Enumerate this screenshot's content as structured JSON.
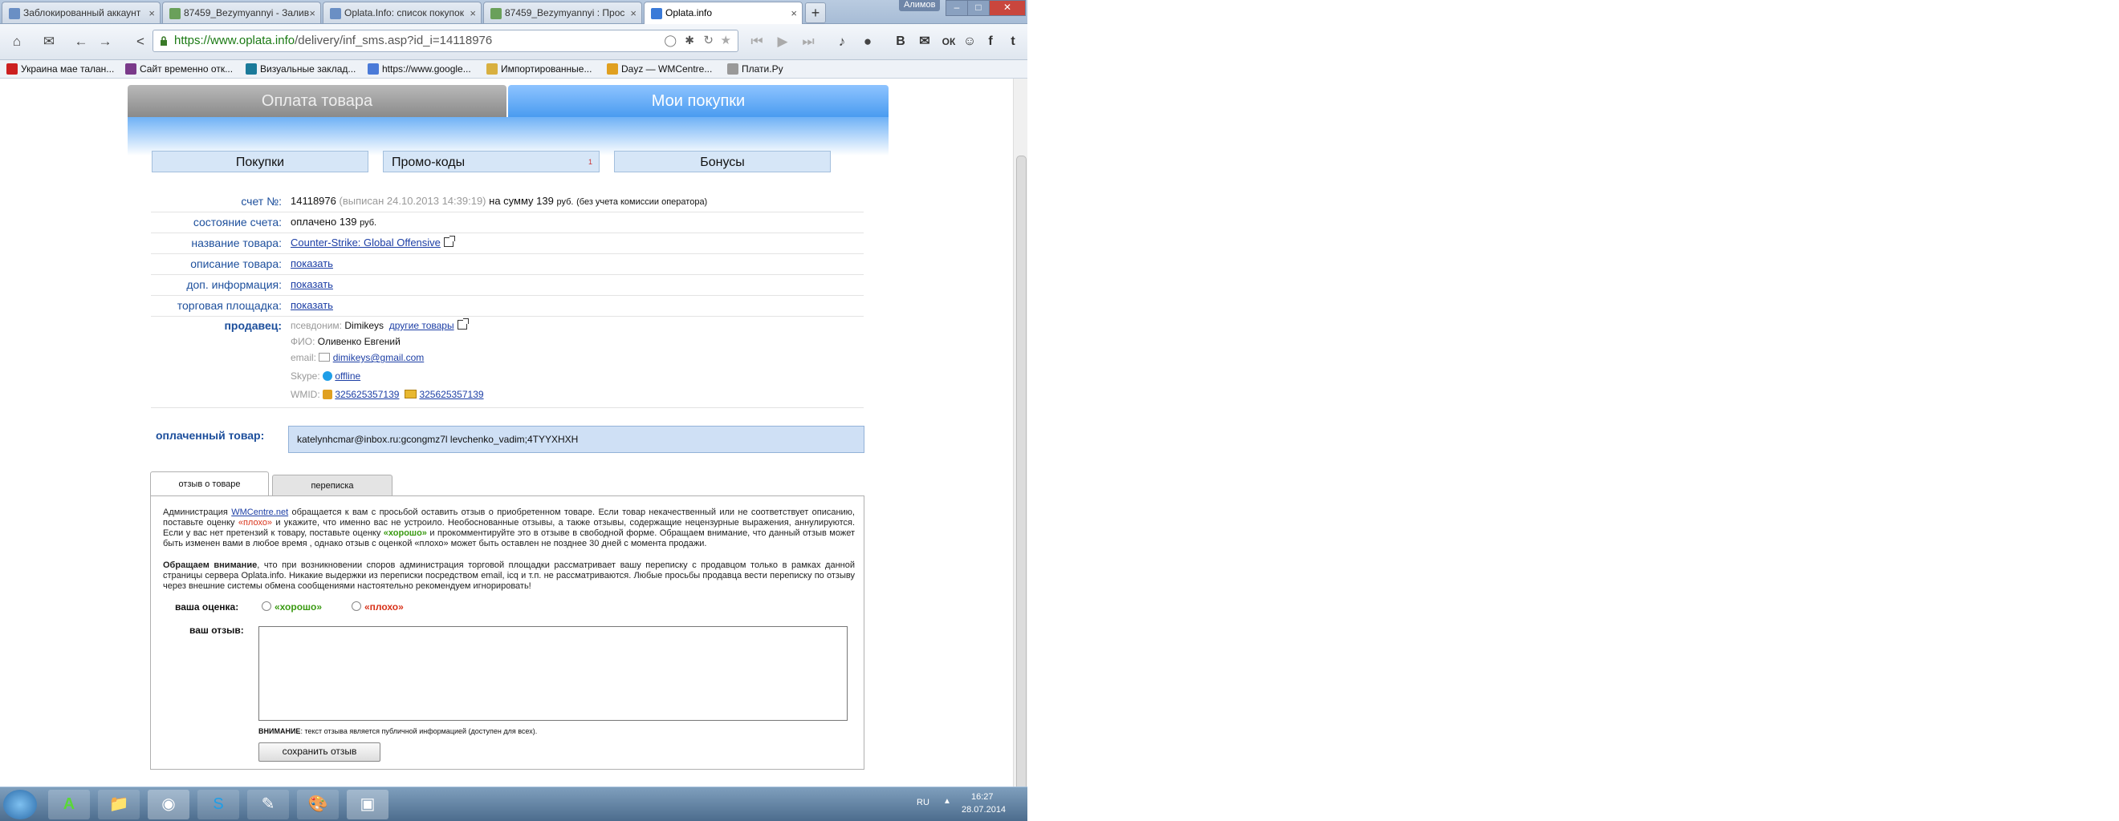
{
  "browser": {
    "tabs": [
      {
        "label": "Заблокированный аккаунт",
        "favicon_color": "#6a8fc4"
      },
      {
        "label": "87459_Bezymyannyi - Залив",
        "favicon_color": "#6aa05a"
      },
      {
        "label": "Oplata.Info: список покупок",
        "favicon_color": "#6a8fc4"
      },
      {
        "label": "87459_Bezymyannyi : Прос",
        "favicon_color": "#6aa05a"
      },
      {
        "label": "Oplata.info",
        "favicon_color": "#3a7ad8",
        "active": true
      }
    ],
    "tab_close": "×",
    "new_tab": "+",
    "window_user": "Алимов",
    "url_scheme": "https://",
    "url_host": "www.oplata.info",
    "url_path": "/delivery/inf_sms.asp?id_i=14118976",
    "social_buttons": [
      "В",
      "✉",
      "ОК",
      "☺",
      "f",
      "t"
    ],
    "bookmarks": [
      {
        "label": "Украина мае талан...",
        "icon_color": "#cc2020"
      },
      {
        "label": "Сайт временно отк...",
        "icon_color": "#7a3a8a"
      },
      {
        "label": "Визуальные заклад...",
        "icon_color": "#1a7a9a"
      },
      {
        "label": "https://www.google...",
        "icon_color": "#4a7ad8"
      },
      {
        "label": "Импортированные...",
        "icon_color": "#d8b040"
      },
      {
        "label": "Dayz — WMCentre...",
        "icon_color": "#e0a020"
      },
      {
        "label": "Плати.Ру",
        "icon_color": "#999999"
      }
    ]
  },
  "page": {
    "main_tabs": {
      "pay": "Оплата товара",
      "my": "Мои покупки"
    },
    "sub_tabs": {
      "purchases": "Покупки",
      "promo": "Промо-коды",
      "promo_badge": "1",
      "bonus": "Бонусы"
    },
    "invoice": {
      "label": "счет №:",
      "number": "14118976",
      "issued": "(выписан 24.10.2013 14:39:19)",
      "sum_prefix": "на сумму",
      "sum": "139",
      "currency": "руб.",
      "note": "(без учета комиссии оператора)"
    },
    "status": {
      "label": "состояние счета:",
      "value": "оплачено 139",
      "currency": "руб."
    },
    "product_name": {
      "label": "название товара:",
      "value": "Counter-Strike: Global Offensive"
    },
    "description": {
      "label": "описание товара:",
      "value": "показать"
    },
    "extra_info": {
      "label": "доп. информация:",
      "value": "показать"
    },
    "marketplace": {
      "label": "торговая площадка:",
      "value": "показать"
    },
    "seller": {
      "label": "продавец:",
      "alias_key": "псевдоним:",
      "alias": "Dimikeys",
      "other_link": "другие товары",
      "name_key": "ФИО:",
      "name": "Оливенко Евгений",
      "email_key": "email:",
      "email": "dimikeys@gmail.com",
      "skype_key": "Skype:",
      "skype": "offline",
      "wmid_key": "WMID:",
      "wmid1": "325625357139",
      "wmid2": "325625357139"
    },
    "paid_goods": {
      "label": "оплаченный товар:",
      "value": "katelynhcmar@inbox.ru:gcongmz7l levchenko_vadim;4TYYXHXH"
    },
    "review_tabs": {
      "review": "отзыв о товаре",
      "chat": "переписка"
    },
    "notice": {
      "p1_a": "Администрация",
      "p1_link": "WMCentre.net",
      "p1_b": "обращается к вам с просьбой оставить отзыв о приобретенном товаре. Если товар некачественный или не соответствует описанию, поставьте оценку",
      "p1_bad": "«плохо»",
      "p1_c": "и укажите, что именно вас не устроило. Необоснованные отзывы, а также отзывы, содержащие нецензурные выражения, аннулируются. Если у вас нет претензий к товару, поставьте оценку",
      "p1_good": "«хорошо»",
      "p1_d": "и прокомментируйте это в отзыве в свободной форме. Обращаем внимание, что данный отзыв может быть изменен вами в любое время , однако отзыв с оценкой «плохо» может быть оставлен не позднее 30 дней с момента продажи.",
      "p2_bold": "Обращаем внимание",
      "p2_rest": ", что при возникновении споров администрация торговой площадки рассматривает вашу переписку с продавцом только в рамках данной страницы сервера Oplata.info. Никакие выдержки из переписки посредством email, icq и т.п. не рассматриваются. Любые просьбы продавца вести переписку по отзыву через внешние системы обмена сообщениями настоятельно рекомендуем игнорировать!"
    },
    "rating": {
      "label": "ваша оценка:",
      "good": "«хорошо»",
      "bad": "«плохо»"
    },
    "review": {
      "label": "ваш отзыв:"
    },
    "warning": {
      "bold": "ВНИМАНИЕ",
      "text": ": текст отзыва является публичной информацией (доступен для всех)."
    },
    "save_button": "сохранить отзыв"
  },
  "taskbar": {
    "items": [
      "start-orb",
      "a-icon",
      "folder-icon",
      "steam-icon",
      "skype-icon",
      "notepad-icon",
      "paint-icon",
      "screenshot-icon"
    ],
    "lang": "RU",
    "time": "16:27",
    "date": "28.07.2014"
  },
  "colors": {
    "accent_blue": "#4a9cf0",
    "label_blue": "#1d4f9c",
    "good": "#3a9a12",
    "bad": "#d8321a"
  }
}
